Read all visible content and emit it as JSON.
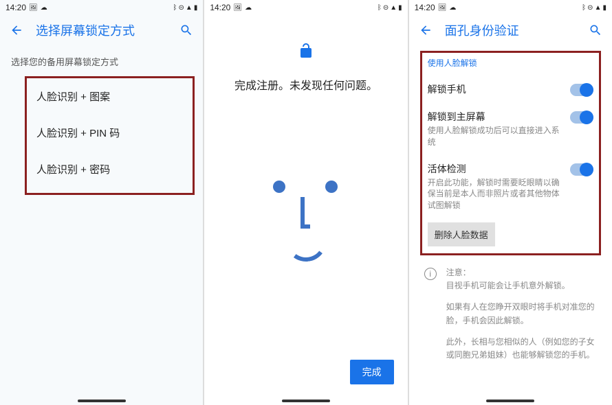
{
  "status": {
    "time": "14:20",
    "left_icons": [
      "image-icon",
      "wechat-icon"
    ],
    "right_icons": [
      "bluetooth-icon",
      "dnd-icon",
      "wifi-icon",
      "battery-icon"
    ]
  },
  "screen1": {
    "title": "选择屏幕锁定方式",
    "subtitle": "选择您的备用屏幕锁定方式",
    "options": [
      "人脸识别 + 图案",
      "人脸识别 + PIN 码",
      "人脸识别 + 密码"
    ]
  },
  "screen2": {
    "message": "完成注册。未发现任何问题。",
    "done_button": "完成"
  },
  "screen3": {
    "title": "面孔身份验证",
    "section_header": "使用人脸解锁",
    "settings": {
      "unlock_phone": {
        "title": "解锁手机",
        "on": true
      },
      "unlock_home": {
        "title": "解锁到主屏幕",
        "sub": "使用人脸解锁成功后可以直接进入系统",
        "on": true
      },
      "liveness": {
        "title": "活体检测",
        "sub": "开启此功能，解锁时需要眨眼睛以确保当前是本人而非照片或者其他物体试图解锁",
        "on": true
      }
    },
    "delete_button": "删除人脸数据",
    "notice": {
      "heading": "注意：",
      "p1": "目视手机可能会让手机意外解锁。",
      "p2": "如果有人在您睁开双眼时将手机对准您的脸，手机会因此解锁。",
      "p3": "此外，长相与您相似的人（例如您的子女或同胞兄弟姐妹）也能够解锁您的手机。"
    }
  }
}
